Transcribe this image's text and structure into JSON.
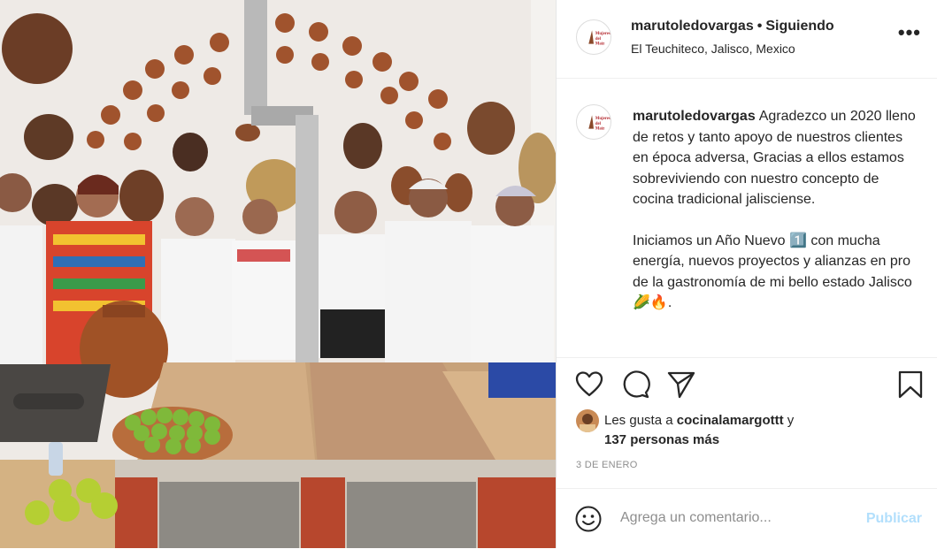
{
  "post": {
    "username": "marutoledovargas",
    "separator": "•",
    "follow_status": "Siguiendo",
    "location": "El Teuchiteco, Jalisco, Mexico",
    "more_label": "•••",
    "caption_part1": "Agradezco un 2020 lleno de retos y tanto apoyo de nuestros clientes en época adversa, Gracias a ellos estamos sobreviviendo con nuestro concepto de cocina tradicional jalisciense.",
    "caption_part2": "Iniciamos un Año Nuevo 1️⃣ con mucha energía, nuevos proyectos y alianzas en pro de la gastronomía de mi bello estado Jalisco 🌽🔥.",
    "likes_prefix": "Les gusta a ",
    "likes_user": "cocinalamargottt",
    "likes_and": " y",
    "likes_count": "137 personas más",
    "date": "3 DE ENERO",
    "comment_placeholder": "Agrega un comentario...",
    "publish_label": "Publicar"
  },
  "icons": {
    "like": "heart-icon",
    "comment": "comment-icon",
    "share": "send-icon",
    "save": "bookmark-icon",
    "emoji": "emoji-icon"
  },
  "colors": {
    "text": "#262626",
    "muted": "#8e8e8e",
    "publish_disabled": "#b2dffc",
    "divider": "#efefef"
  }
}
